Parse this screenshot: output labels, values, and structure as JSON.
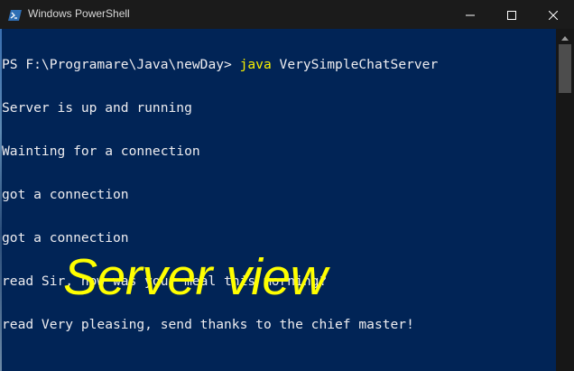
{
  "window": {
    "title": "Windows PowerShell"
  },
  "titlebar_icons": {
    "app": "powershell-icon",
    "minimize": "minimize-icon",
    "maximize": "maximize-icon",
    "close": "close-icon"
  },
  "console": {
    "prompt": "PS F:\\Programare\\Java\\newDay> ",
    "command_name": "java",
    "command_args": " VerySimpleChatServer",
    "lines": [
      "Server is up and running",
      "Wainting for a connection",
      "got a connection",
      "got a connection",
      "read Sir, how was your meal this morning?",
      "read Very pleasing, send thanks to the chief master!"
    ]
  },
  "caption": {
    "text": "Server view"
  },
  "colors": {
    "background": "#012456",
    "text": "#eeedf0",
    "command": "#f8f000",
    "caption": "#ffff00",
    "titlebar": "#1b1b1b"
  }
}
